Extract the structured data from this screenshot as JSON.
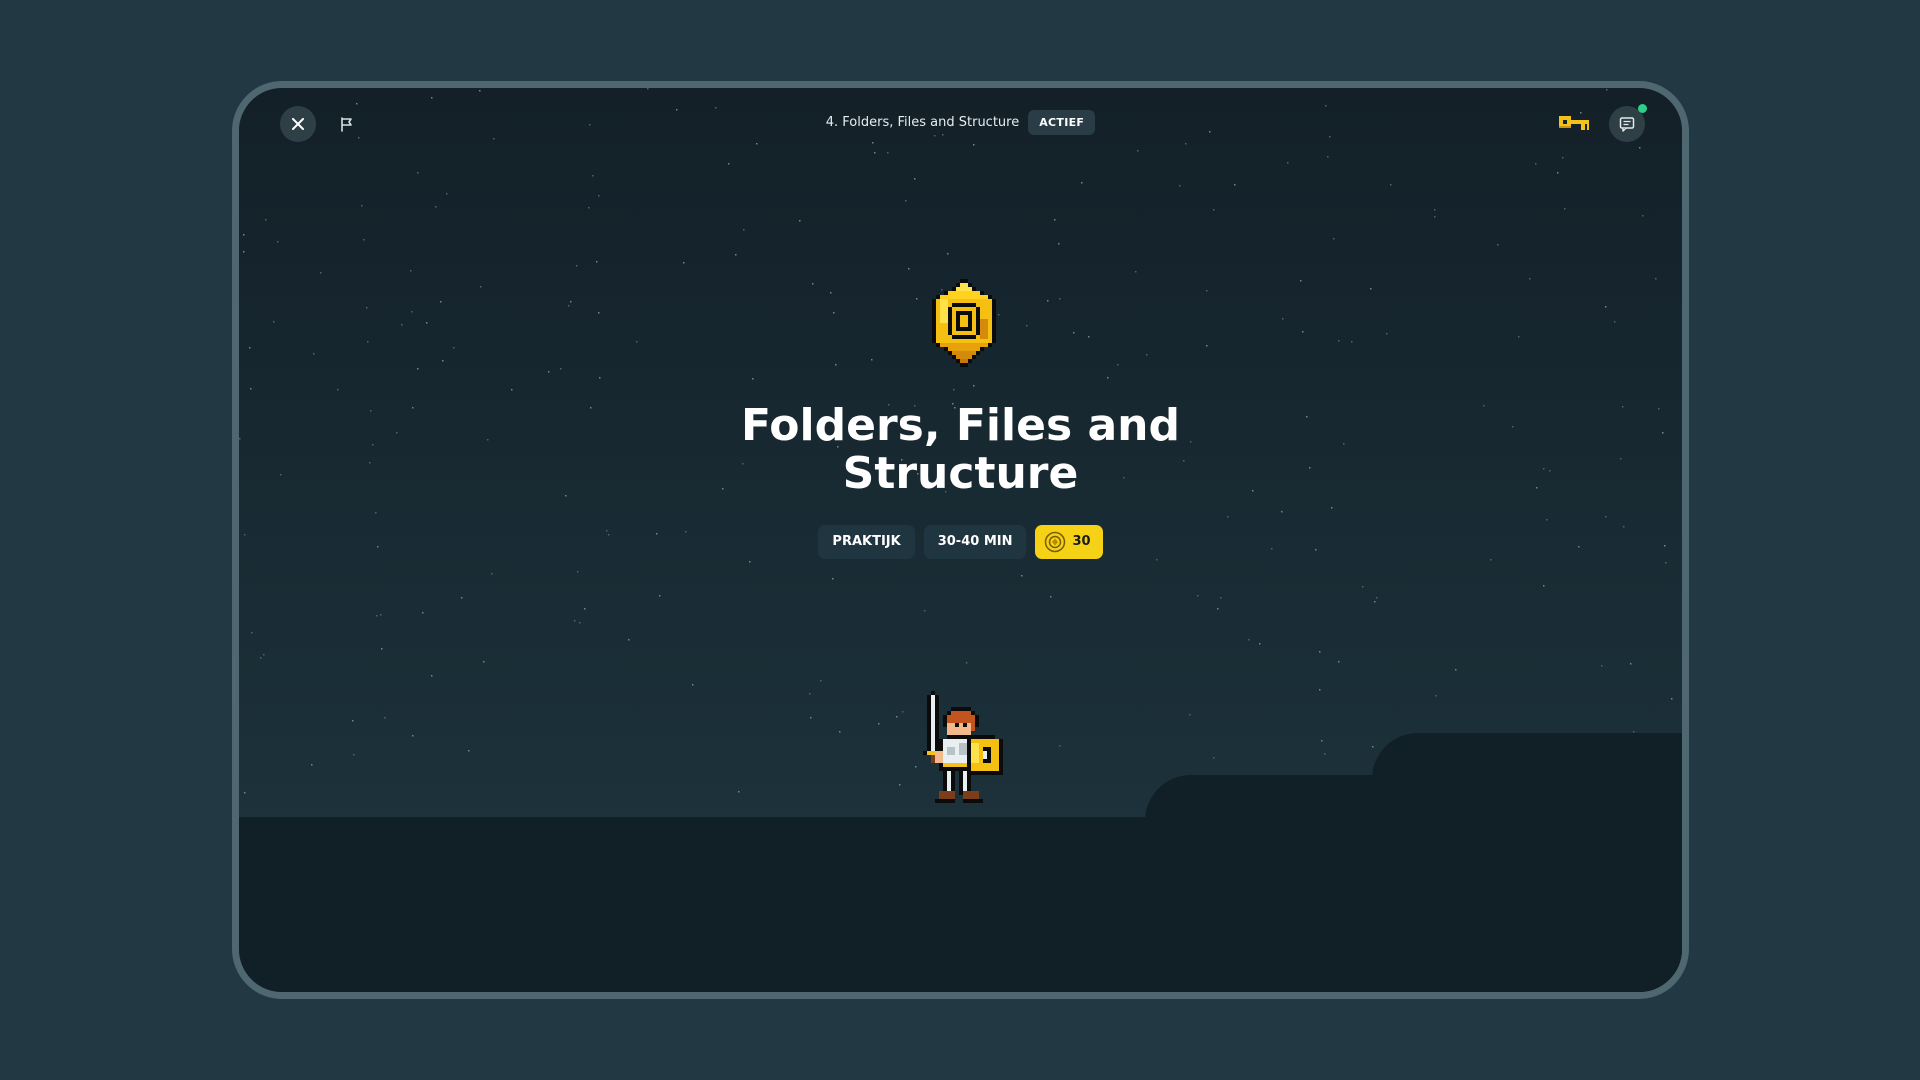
{
  "header": {
    "lesson_label": "4. Folders, Files and Structure",
    "status_badge": "ACTIEF"
  },
  "lesson": {
    "title": "Folders, Files and Structure",
    "tags": {
      "type": "PRAKTIJK",
      "duration": "30-40 MIN",
      "coins": "30"
    }
  },
  "icons": {
    "close": "close-icon",
    "flag": "flag-icon",
    "key": "key-icon",
    "chat": "chat-icon",
    "gem": "gem-icon",
    "coin": "coin-icon",
    "character": "knight-character"
  },
  "colors": {
    "background": "#223943",
    "screen": "#132028",
    "ground": "#111f26",
    "accent_yellow": "#f5d216",
    "notification_green": "#2bd189"
  }
}
